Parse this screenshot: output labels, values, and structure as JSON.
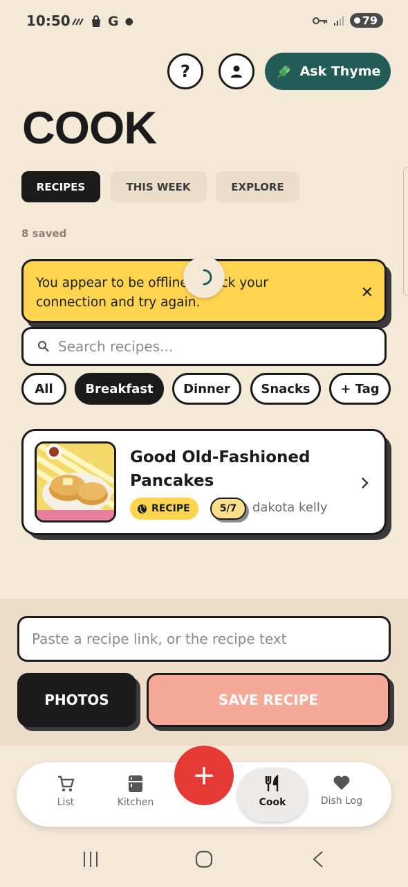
{
  "status_bar": {
    "time": "10:50",
    "battery": "79",
    "left_icons": [
      "missed-call-icon",
      "shopping-bag-icon",
      "google-icon",
      "dot-icon"
    ],
    "right_icons": [
      "vpn-key-icon",
      "signal-icon",
      "battery-icon"
    ]
  },
  "header": {
    "help_label": "?",
    "ask_label": "Ask Thyme",
    "title": "COOK"
  },
  "tabs": [
    {
      "label": "RECIPES",
      "active": true
    },
    {
      "label": "THIS WEEK",
      "active": false
    },
    {
      "label": "EXPLORE",
      "active": false
    }
  ],
  "saved_count": "8 saved",
  "banner": {
    "text": "You appear to be offline. Check your connection and try again.",
    "close": "✕"
  },
  "search": {
    "placeholder": "Search recipes..."
  },
  "filters": [
    {
      "label": "All",
      "active": false
    },
    {
      "label": "Breakfast",
      "active": true
    },
    {
      "label": "Dinner",
      "active": false
    },
    {
      "label": "Snacks",
      "active": false
    },
    {
      "label": "+ Tag",
      "active": false
    }
  ],
  "recipes": [
    {
      "title": "Good Old-Fashioned Pancakes",
      "badge": "RECIPE",
      "score": "5/7",
      "author": "dakota kelly"
    }
  ],
  "import": {
    "placeholder": "Paste a recipe link, or the recipe text",
    "photos_label": "PHOTOS",
    "save_label": "SAVE RECIPE"
  },
  "nav": {
    "items": [
      {
        "label": "List",
        "icon": "cart-icon"
      },
      {
        "label": "Kitchen",
        "icon": "fridge-icon"
      },
      {
        "label": "Cook",
        "icon": "utensils-icon",
        "active": true
      },
      {
        "label": "Dish Log",
        "icon": "heart-icon"
      }
    ],
    "fab": "+"
  },
  "colors": {
    "background": "#F4E8D6",
    "accent_teal": "#235B57",
    "banner_yellow": "#FFD54F",
    "fab_red": "#E53935",
    "save_pink": "#F7A999"
  }
}
